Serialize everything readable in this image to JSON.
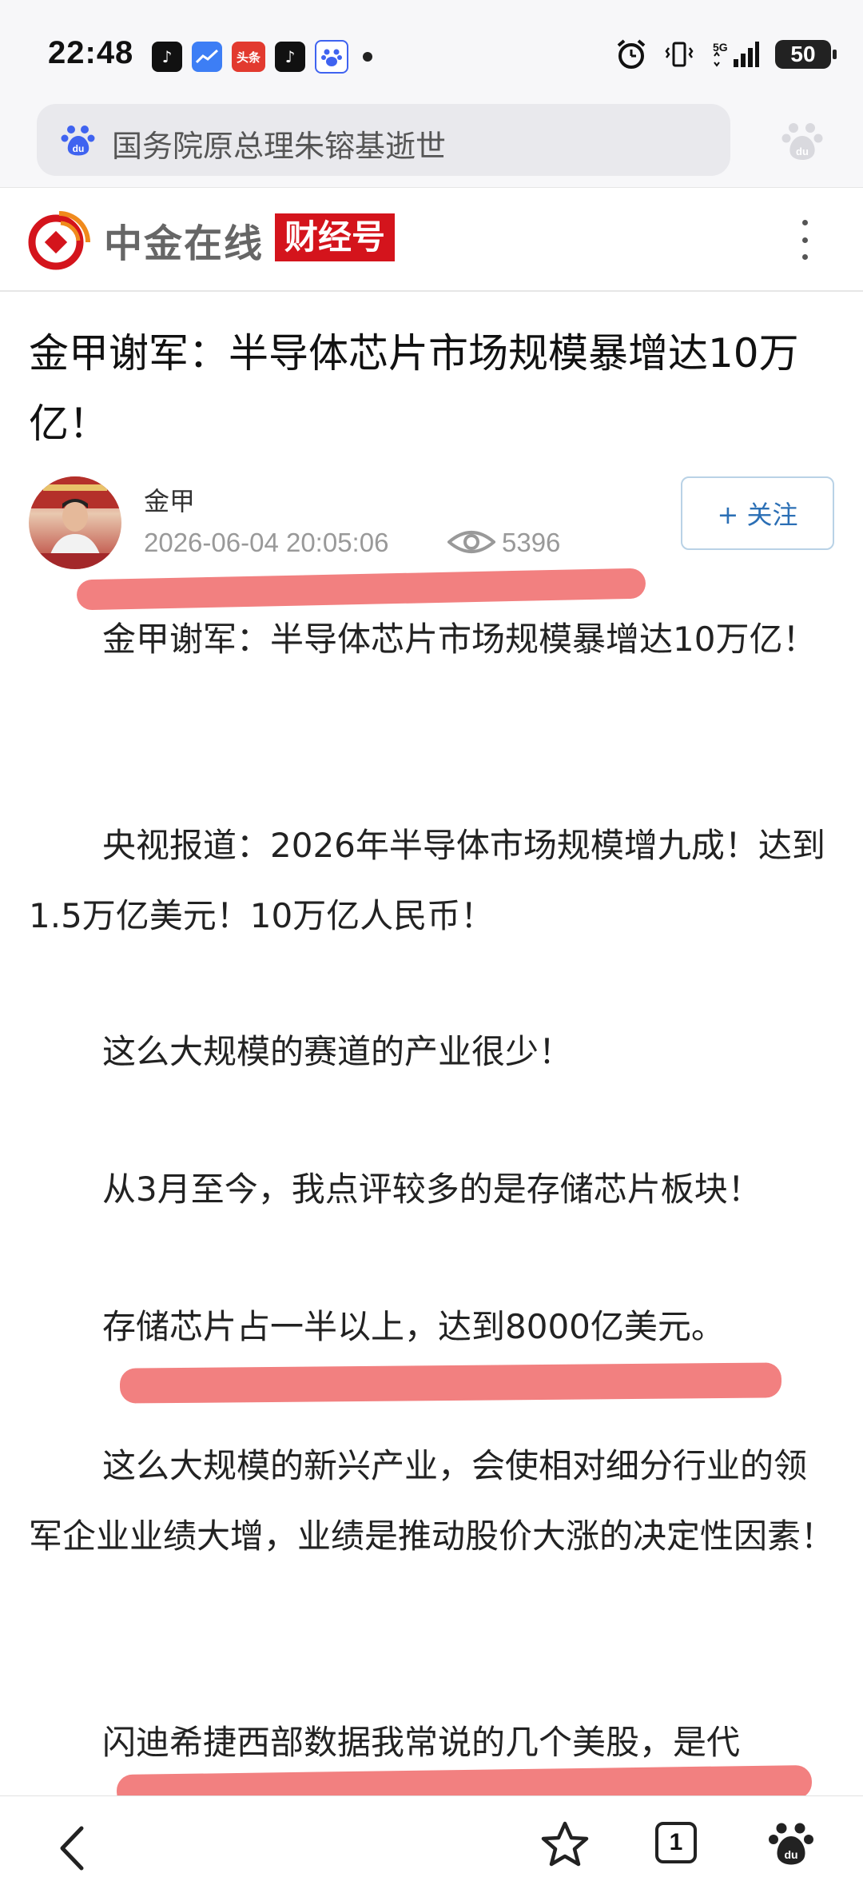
{
  "status_bar": {
    "time": "22:48",
    "notification_icons": [
      "tiktok-icon",
      "stock-chart-icon",
      "toutiao-icon",
      "tiktok-icon",
      "baidu-icon"
    ],
    "toutiao_label": "头条",
    "network": "5G",
    "battery": "50"
  },
  "search": {
    "query": "国务院原总理朱镕基逝世"
  },
  "source": {
    "name": "中金在线",
    "tag": "财经号"
  },
  "article": {
    "title": "金甲谢军：半导体芯片市场规模暴增达10万亿！",
    "author": "金甲",
    "datetime": "2026-06-04 20:05:06",
    "views": "5396",
    "follow_label": "+ 关注",
    "paragraphs": [
      "金甲谢军：半导体芯片市场规模暴增达10万亿！",
      "央视报道：2026年半导体市场规模增九成！达到1.5万亿美元！10万亿人民币！",
      "这么大规模的赛道的产业很少！",
      "从3月至今，我点评较多的是存储芯片板块！",
      "存储芯片占一半以上，达到8000亿美元。",
      "这么大规模的新兴产业，会使相对细分行业的领军企业业绩大增，业绩是推动股价大涨的决定性因素！",
      "闪迪希捷西部数据我常说的几个美股，是代"
    ]
  },
  "bottom_bar": {
    "tab_count": "1"
  },
  "colors": {
    "brand_red": "#d4141c",
    "highlight": "#f06a6a",
    "follow_blue": "#2b6fb5"
  }
}
